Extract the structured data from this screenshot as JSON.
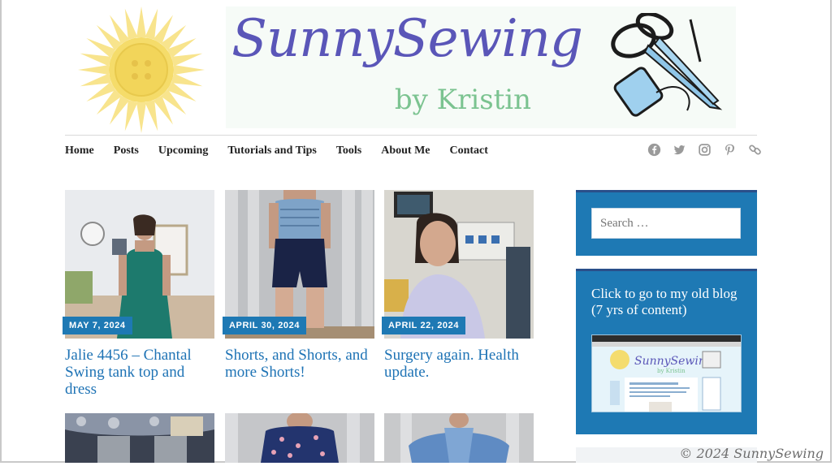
{
  "header": {
    "brand_title": "SunnySewing",
    "brand_sub": "by Kristin"
  },
  "nav": {
    "items": [
      "Home",
      "Posts",
      "Upcoming",
      "Tutorials and Tips",
      "Tools",
      "About Me",
      "Contact"
    ]
  },
  "social": {
    "icons": [
      "facebook-icon",
      "twitter-icon",
      "instagram-icon",
      "pinterest-icon",
      "link-icon"
    ]
  },
  "posts": [
    {
      "date": "MAY 7, 2024",
      "title": "Jalie 4456 – Chantal Swing tank top and dress"
    },
    {
      "date": "APRIL 30, 2024",
      "title": "Shorts, and Shorts, and more Shorts!"
    },
    {
      "date": "APRIL 22, 2024",
      "title": "Surgery again. Health update."
    }
  ],
  "sidebar": {
    "search_placeholder": "Search …",
    "old_blog_text": "Click to go to my old blog (7 yrs of content)"
  },
  "watermark": "© 2024 SunnySewing",
  "colors": {
    "accent_blue": "#1e79b4",
    "link_blue": "#1e73b5",
    "brand_purple": "#5a56b8",
    "brand_green": "#7bc390"
  }
}
